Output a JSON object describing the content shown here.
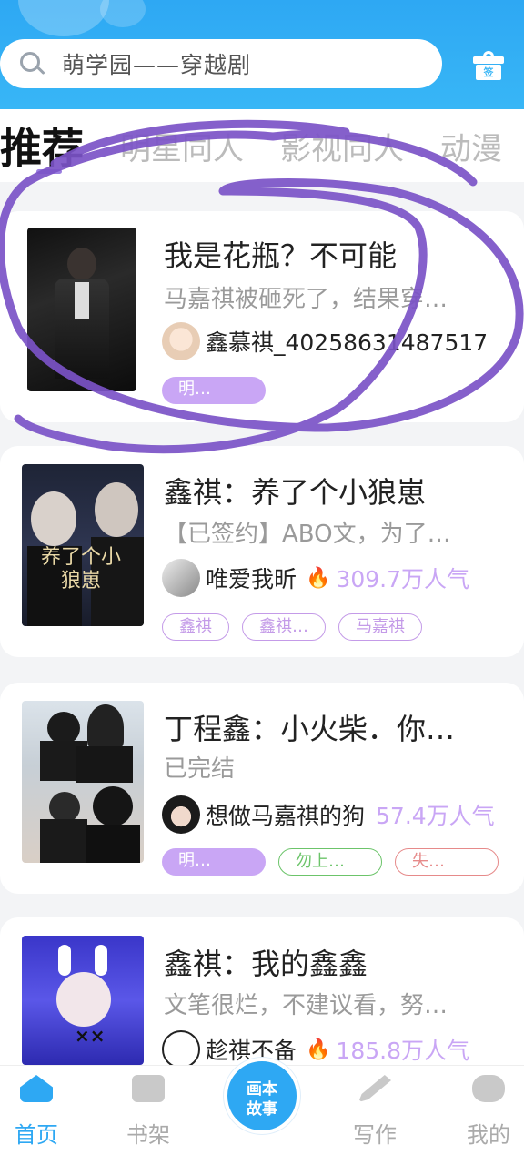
{
  "search": {
    "text": "萌学园——穿越剧",
    "gift_label": "签"
  },
  "tabs": [
    "推荐",
    "明星同人",
    "影视同人",
    "动漫"
  ],
  "cards": [
    {
      "title": "我是花瓶？不可能",
      "desc": "马嘉祺被砸死了，结果穿…",
      "author": "鑫慕祺_40258631487517",
      "popularity": "",
      "tags": [
        {
          "label": "明…",
          "style": "fill"
        }
      ]
    },
    {
      "title": "鑫祺：养了个小狼崽",
      "desc": "【已签约】ABO文，为了…",
      "author": "唯爱我昕",
      "popularity": "309.7万人气",
      "tags": [
        {
          "label": "鑫祺",
          "style": "out-purple"
        },
        {
          "label": "鑫祺…",
          "style": "out-purple"
        },
        {
          "label": "马嘉祺",
          "style": "out-purple"
        }
      ],
      "cover_text": "养了个小狼崽"
    },
    {
      "title": "丁程鑫：小火柴．你…",
      "desc": "已完结",
      "author": "想做马嘉祺的狗",
      "popularity": "57.4万人气",
      "tags": [
        {
          "label": "明…",
          "style": "fill"
        },
        {
          "label": "勿上…",
          "style": "out-green"
        },
        {
          "label": "失…",
          "style": "out-red"
        }
      ]
    },
    {
      "title": "鑫祺：我的鑫鑫",
      "desc": "文笔很烂，不建议看，努…",
      "author": "趁祺不备",
      "popularity": "185.8万人气",
      "tags": []
    }
  ],
  "nav": {
    "home": "首页",
    "shelf": "书架",
    "center": [
      "画本",
      "故事"
    ],
    "write": "写作",
    "mine": "我的"
  },
  "colors": {
    "accent": "#2ea8f3",
    "tag_purple": "#c9a6f5",
    "scribble": "#7b52c7"
  }
}
